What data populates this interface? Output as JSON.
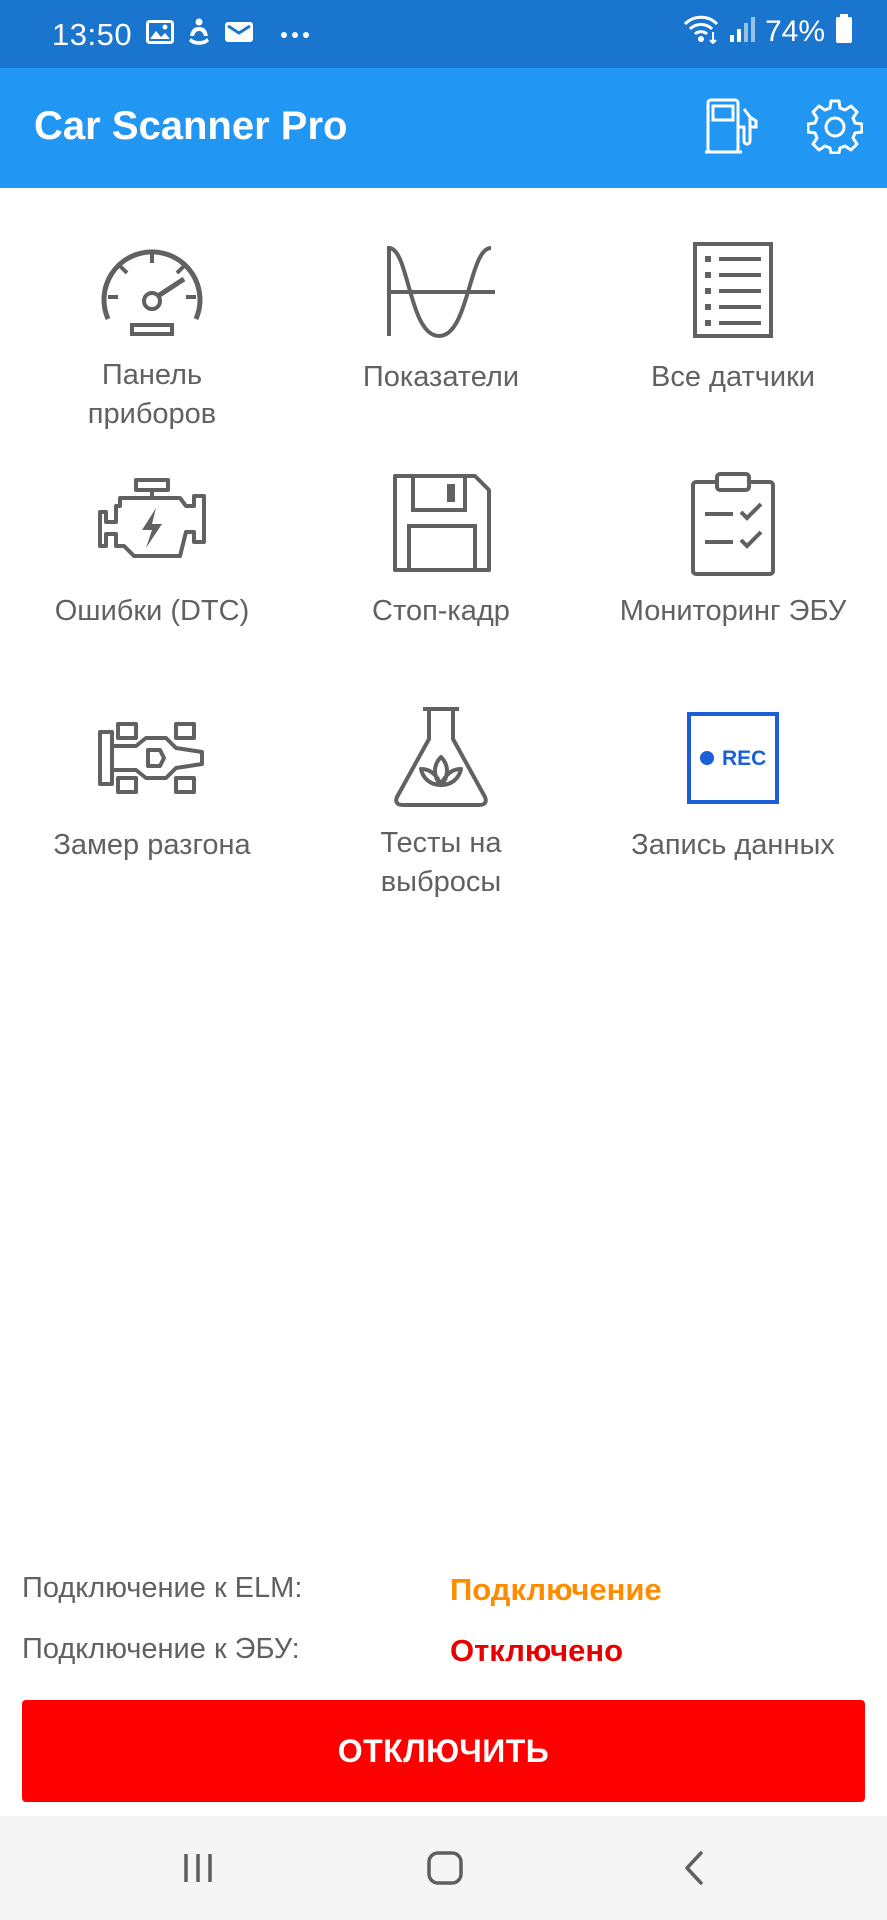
{
  "status_bar": {
    "time": "13:50",
    "battery": "74%",
    "left_icons": [
      "image-icon",
      "accessibility-icon",
      "mail-icon",
      "more-dots-icon"
    ],
    "right_icons": [
      "wifi-icon",
      "signal-icon",
      "battery-icon"
    ]
  },
  "app_bar": {
    "title": "Car Scanner Pro",
    "actions": [
      "fuel-pump-icon",
      "settings-gear-icon"
    ],
    "background_color": "#2196f3"
  },
  "tiles": [
    {
      "label": "Панель\nприборов",
      "icon": "dashboard-gauge-icon"
    },
    {
      "label": "Показатели",
      "icon": "sine-wave-icon"
    },
    {
      "label": "Все датчики",
      "icon": "list-document-icon"
    },
    {
      "label": "Ошибки (DTC)",
      "icon": "engine-check-icon"
    },
    {
      "label": "Стоп-кадр",
      "icon": "floppy-disk-icon"
    },
    {
      "label": "Мониторинг ЭБУ",
      "icon": "clipboard-checklist-icon"
    },
    {
      "label": "Замер разгона",
      "icon": "race-car-icon"
    },
    {
      "label": "Тесты на\nвыбросы",
      "icon": "emissions-flask-icon"
    },
    {
      "label": "Запись данных",
      "icon": "rec-icon",
      "icon_text": "REC"
    }
  ],
  "connection": {
    "elm_label": "Подключение к ELM:",
    "elm_value": "Подключение",
    "elm_color": "#ff8c00",
    "ecu_label": "Подключение к ЭБУ:",
    "ecu_value": "Отключено",
    "ecu_color": "#e60000"
  },
  "disconnect_button": {
    "label": "ОТКЛЮЧИТЬ",
    "color": "#ff0000"
  },
  "nav_bar": {
    "buttons": [
      "recent-apps-icon",
      "home-icon",
      "back-icon"
    ]
  }
}
